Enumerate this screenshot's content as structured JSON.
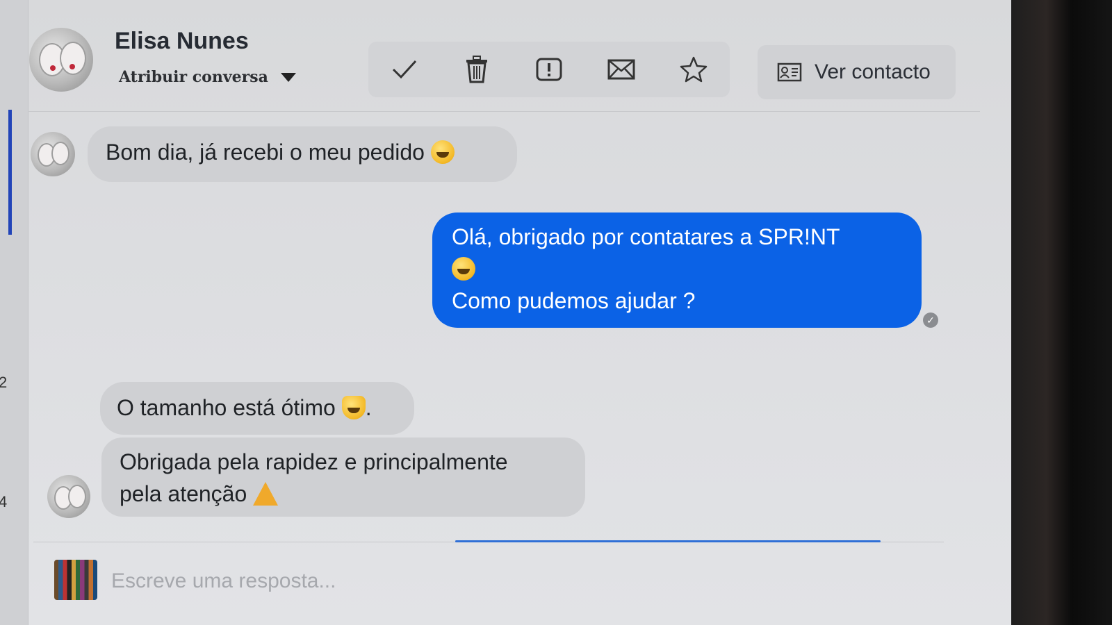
{
  "header": {
    "contact_name": "Elisa Nunes",
    "assign_label": "Atribuir conversa",
    "ver_contacto_label": "Ver contacto"
  },
  "messages": [
    {
      "direction": "in",
      "text": "Bom dia, já recebi o meu pedido",
      "emoji": "grinning-face"
    },
    {
      "direction": "out",
      "lines": [
        "Olá, obrigado por contatares a SPR!NT",
        "Como pudemos ajudar ?"
      ],
      "emoji": "grinning-face",
      "status": "seen"
    },
    {
      "direction": "in",
      "text": "O tamanho está ótimo",
      "emoji": "smiling-cat",
      "suffix": "."
    },
    {
      "direction": "in",
      "lines": [
        "Obrigada pela rapidez e principalmente",
        "pela atenção"
      ],
      "emoji": "folded-hands"
    }
  ],
  "composer": {
    "placeholder": "Escreve uma resposta..."
  },
  "sidebar_numbers": [
    "2",
    "4"
  ],
  "colors": {
    "outgoing_bubble": "#0b62e6",
    "incoming_bubble": "#cfd0d3",
    "background": "#dcdde0"
  },
  "icons": [
    "check-icon",
    "trash-icon",
    "report-icon",
    "mail-icon",
    "star-icon",
    "contact-card-icon"
  ]
}
